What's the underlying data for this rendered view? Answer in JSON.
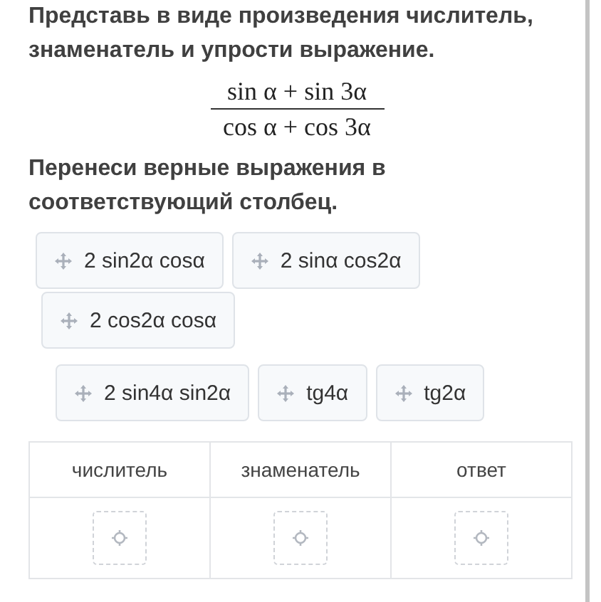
{
  "task": {
    "instruction": "Представь в виде произведения числитель, знаменатель и упрости выражение.",
    "numerator": "sin α + sin 3α",
    "denominator": "cos α + cos 3α",
    "prompt": "Перенеси верные выражения в соответствующий столбец."
  },
  "chip_rows": [
    {
      "chips": [
        "2 sin2α cosα",
        "2 sinα cos2α"
      ]
    },
    {
      "chips": [
        "2 cos2α cosα"
      ]
    },
    {
      "chips": [
        "2 sin4α sin2α",
        "tg4α",
        "tg2α"
      ]
    }
  ],
  "table": {
    "columns": [
      "числитель",
      "знаменатель",
      "ответ"
    ]
  }
}
